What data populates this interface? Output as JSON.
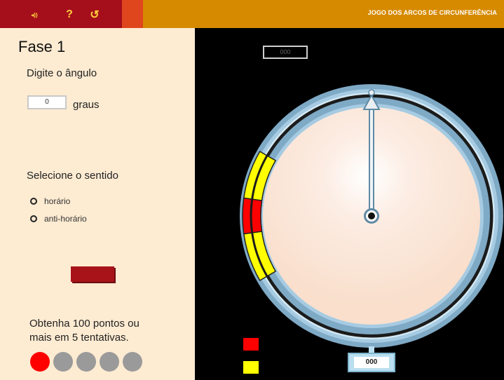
{
  "header": {
    "sound_label": "◂))",
    "help_label": "?",
    "restart_label": "↺",
    "title": "JOGO DOS ARCOS DE CIRCUNFERÊNCIA"
  },
  "left_panel": {
    "phase": "Fase 1",
    "angle_prompt": "Digite o ângulo",
    "angle_value": "0",
    "angle_unit": "graus",
    "direction_prompt": "Selecione o sentido",
    "options": [
      {
        "label": "horário",
        "selected": false
      },
      {
        "label": "anti-horário",
        "selected": false
      }
    ],
    "goal_line1": "Obtenha 100 pontos ou",
    "goal_line2": "mais em 5 tentativas.",
    "attempts": [
      "active",
      "pending",
      "pending",
      "pending",
      "pending"
    ]
  },
  "game": {
    "score": "000",
    "reading": "000",
    "pointer_angle_deg": 0,
    "target_arcs": [
      {
        "color": "#ffff00",
        "from_deg": 240,
        "to_deg": 262
      },
      {
        "color": "#ff0000",
        "from_deg": 262,
        "to_deg": 278
      },
      {
        "color": "#ffff00",
        "from_deg": 278,
        "to_deg": 300
      }
    ]
  },
  "colors": {
    "active_attempt": "#ff0000",
    "pending_attempt": "#9a9a9a",
    "ring_blue": "#9fc4dc",
    "dial_face": "#fce6d6"
  }
}
